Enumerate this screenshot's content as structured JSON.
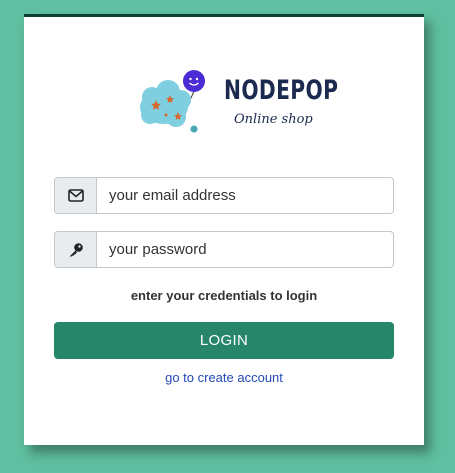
{
  "logo": {
    "brand": "NODEPOP",
    "tagline": "Online shop"
  },
  "form": {
    "email_placeholder": "your email address",
    "password_placeholder": "your password",
    "hint": "enter your credentials to login",
    "login_label": "LOGIN",
    "create_account_label": "go to create account"
  },
  "icons": {
    "email": "envelope-icon",
    "password": "key-icon",
    "logo": "cloud-balloon-icon"
  },
  "colors": {
    "background": "#5fbfa0",
    "card_border": "#0f3d34",
    "button": "#27866a",
    "link": "#2449b8",
    "brand_text": "#1c2a4f"
  }
}
